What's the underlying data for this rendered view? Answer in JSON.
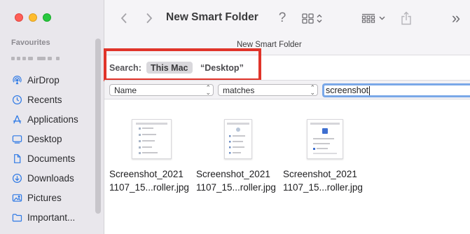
{
  "sidebar": {
    "section_title": "Favourites",
    "items": [
      {
        "label": "AirDrop",
        "icon": "airdrop-icon"
      },
      {
        "label": "Recents",
        "icon": "clock-icon"
      },
      {
        "label": "Applications",
        "icon": "applications-icon"
      },
      {
        "label": "Desktop",
        "icon": "desktop-icon"
      },
      {
        "label": "Documents",
        "icon": "document-icon"
      },
      {
        "label": "Downloads",
        "icon": "download-icon"
      },
      {
        "label": "Pictures",
        "icon": "photo-icon"
      },
      {
        "label": "Important...",
        "icon": "folder-icon"
      }
    ]
  },
  "toolbar": {
    "title": "New Smart Folder",
    "help_label": "?",
    "more_label": "»",
    "tab_title": "New Smart Folder"
  },
  "search": {
    "label": "Search:",
    "scope_this_mac": "This Mac",
    "scope_desktop": "“Desktop”",
    "attribute": "Name",
    "operator": "matches",
    "query": "screenshot"
  },
  "files": [
    {
      "line1": "Screenshot_2021",
      "line2": "1107_15...roller.jpg"
    },
    {
      "line1": "Screenshot_2021",
      "line2": "1107_15...roller.jpg"
    },
    {
      "line1": "Screenshot_2021",
      "line2": "1107_15...roller.jpg"
    }
  ],
  "colors": {
    "highlight_box": "#e0342a",
    "accent": "#2f7ae5",
    "search_focus": "#7aa8e8"
  }
}
